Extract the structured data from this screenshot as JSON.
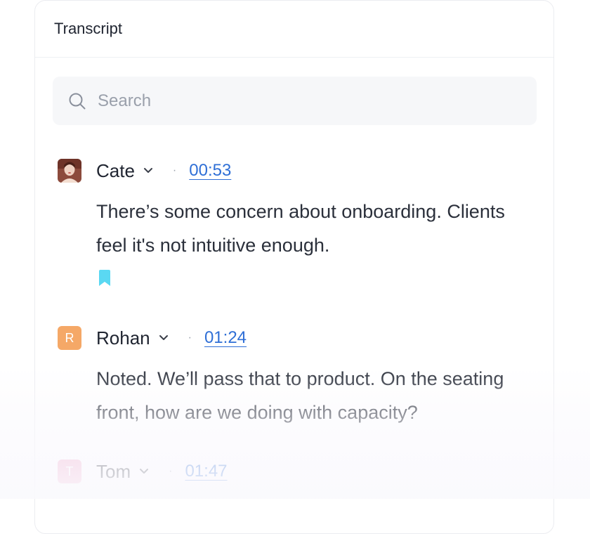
{
  "panel": {
    "title": "Transcript"
  },
  "search": {
    "placeholder": "Search",
    "icon": "search-icon"
  },
  "entries": [
    {
      "speaker": "Cate",
      "initial": "",
      "timestamp": "00:53",
      "text": "There’s some concern about onboarding. Clients feel it's not intuitive enough.",
      "bookmarked": true,
      "avatar_color": "#8c4a3c"
    },
    {
      "speaker": "Rohan",
      "initial": "R",
      "timestamp": "01:24",
      "text": "Noted. We’ll pass that to product. On the seating front, how are we doing with capacity?",
      "bookmarked": false,
      "avatar_color": "#f5a867"
    },
    {
      "speaker": "Tom",
      "initial": "T",
      "timestamp": "01:47",
      "text": "",
      "bookmarked": false,
      "avatar_color": "#f3a7c9"
    }
  ],
  "colors": {
    "link": "#2f6fd6",
    "bookmark": "#5ad8f2",
    "text": "#2b303b"
  }
}
